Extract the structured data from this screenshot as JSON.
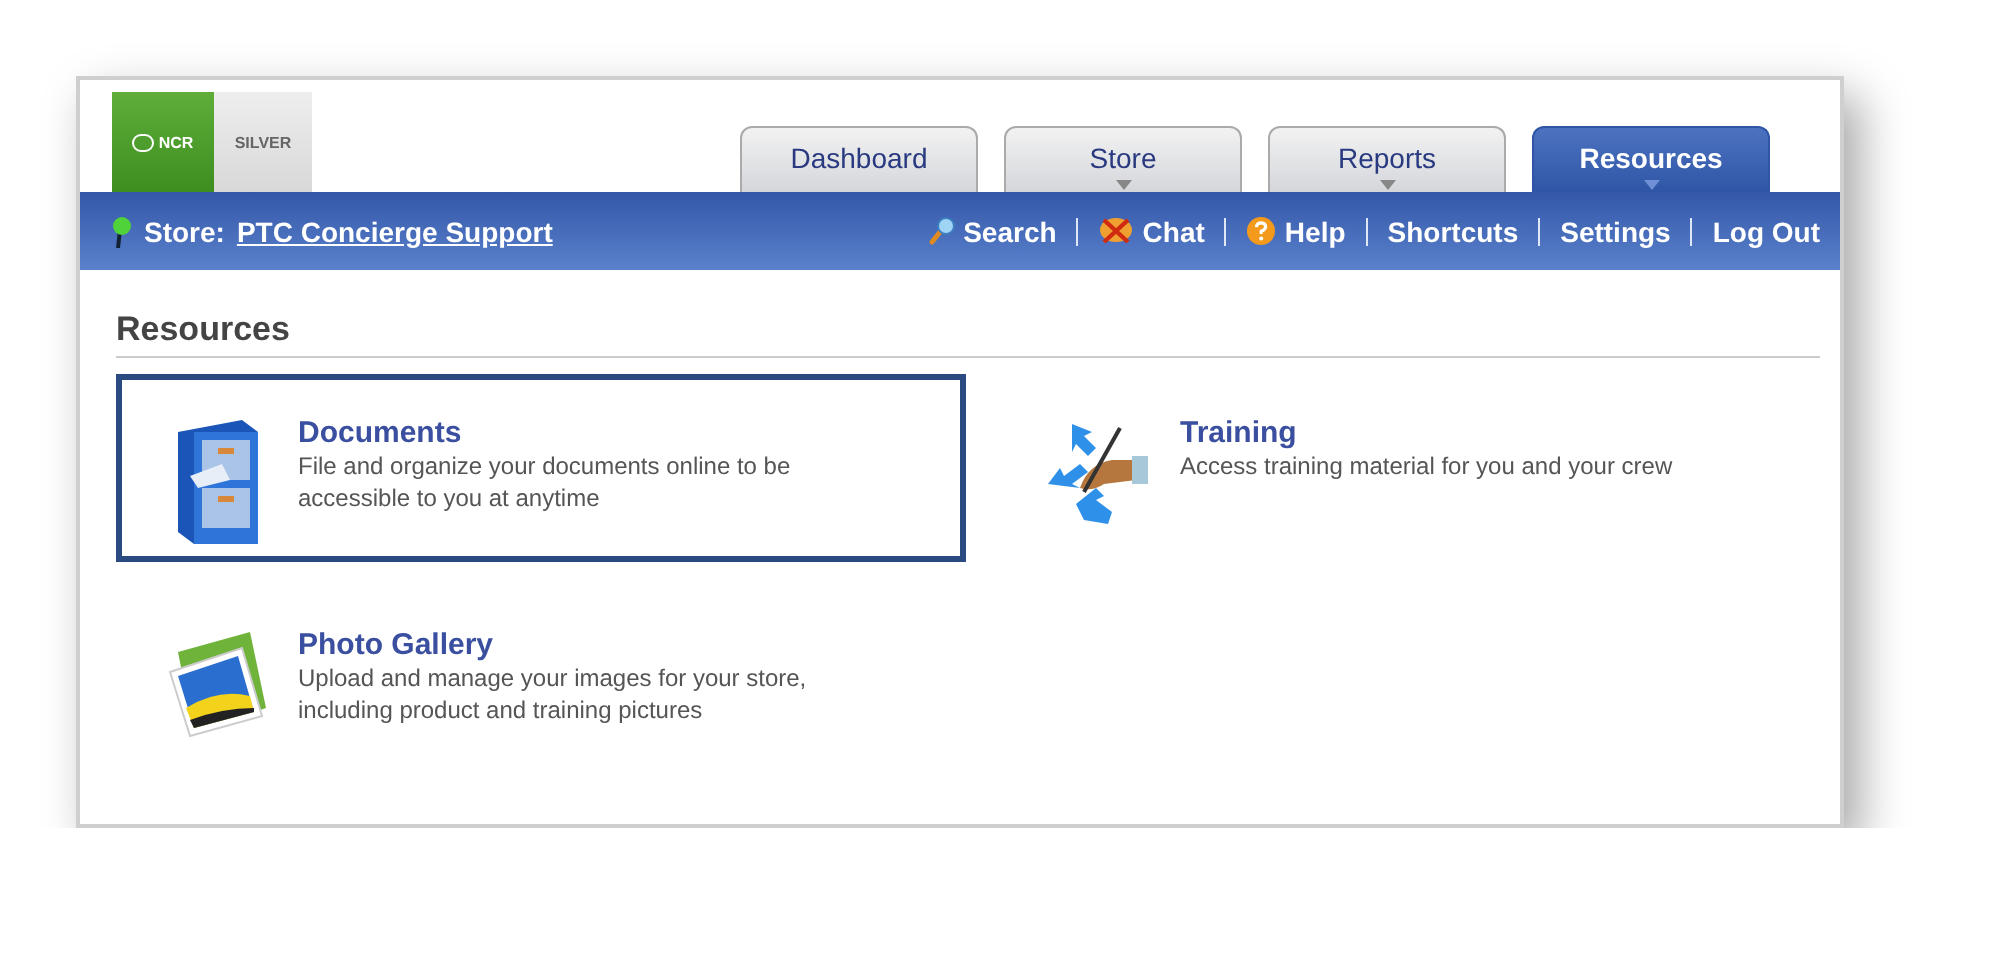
{
  "logo": {
    "brand": "NCR",
    "product": "SILVER"
  },
  "tabs": [
    {
      "label": "Dashboard",
      "selected": false,
      "menu": false
    },
    {
      "label": "Store",
      "selected": false,
      "menu": true
    },
    {
      "label": "Reports",
      "selected": false,
      "menu": true
    },
    {
      "label": "Resources",
      "selected": true,
      "menu": true
    }
  ],
  "nav_bar": {
    "store_label": "Store:",
    "store_name": "PTC Concierge Support",
    "links": [
      {
        "label": "Search",
        "kind": "search"
      },
      {
        "label": "Chat",
        "kind": "chat"
      },
      {
        "label": "Help",
        "kind": "help"
      },
      {
        "label": "Shortcuts",
        "kind": "plain"
      },
      {
        "label": "Settings",
        "kind": "plain"
      },
      {
        "label": "Log Out",
        "kind": "plain"
      }
    ]
  },
  "page_title": "Resources",
  "resources": [
    {
      "kind": "documents",
      "title": "Documents",
      "description": "File and organize your documents online to be accessible to you at anytime",
      "selected": true
    },
    {
      "kind": "training",
      "title": "Training",
      "description": "Access training material for you and your crew",
      "selected": false
    },
    {
      "kind": "gallery",
      "title": "Photo Gallery",
      "description": "Upload and manage your images for your store, including product and training pictures",
      "selected": false
    }
  ]
}
